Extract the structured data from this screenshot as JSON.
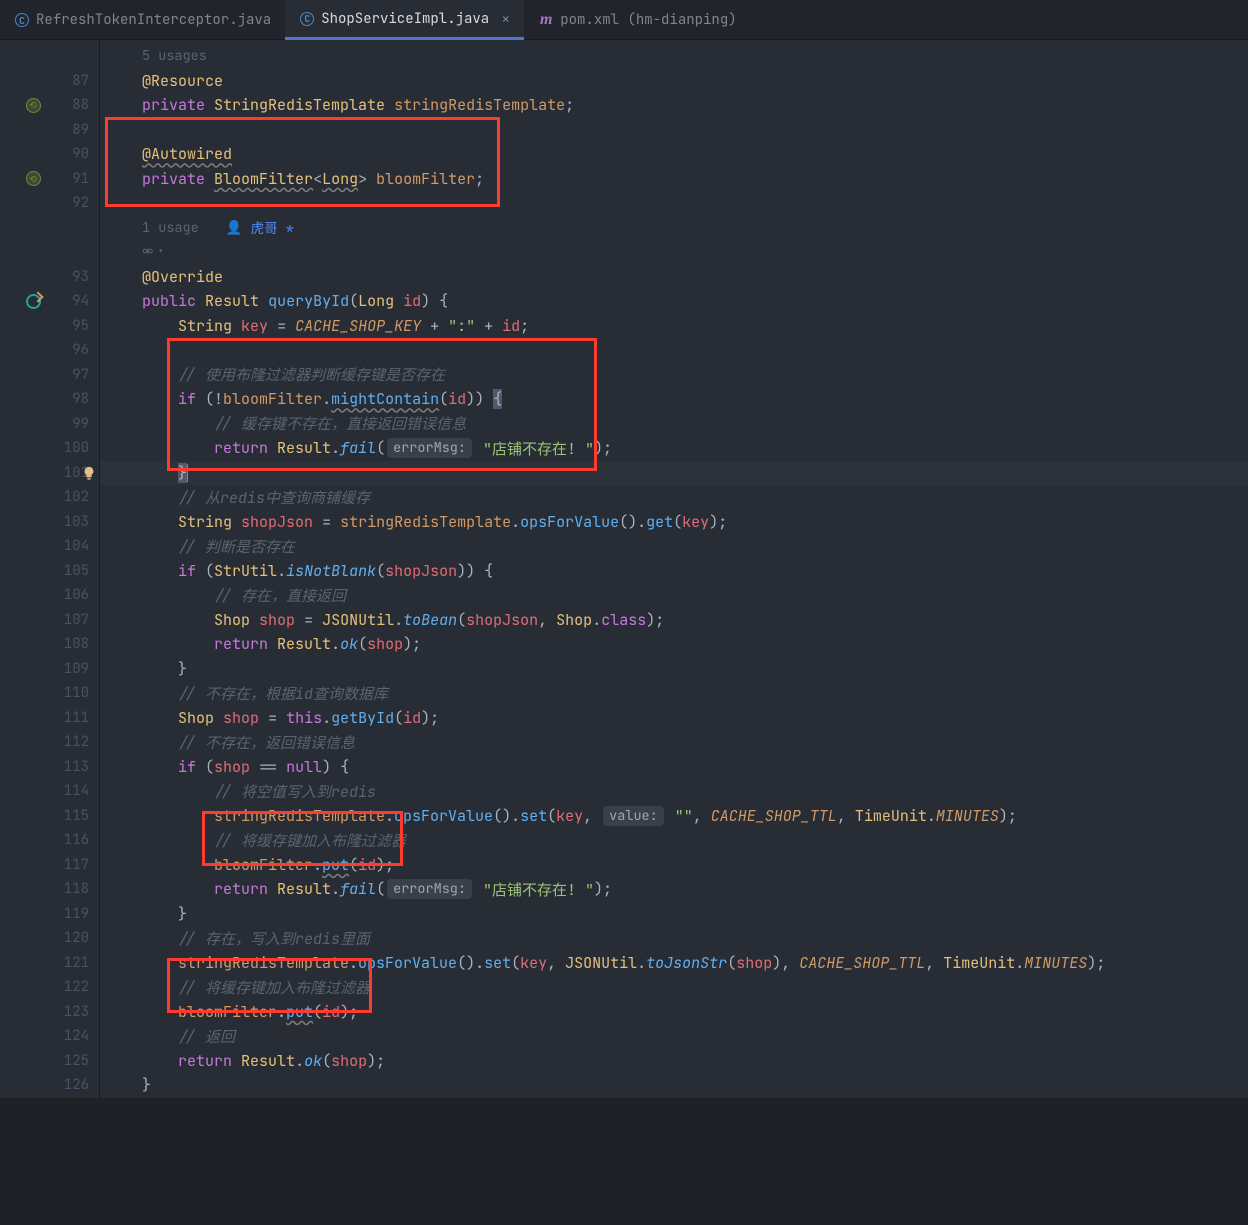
{
  "tabs": [
    {
      "label": "RefreshTokenInterceptor.java",
      "icon": "class"
    },
    {
      "label": "ShopServiceImpl.java",
      "icon": "class",
      "active": true
    },
    {
      "label": "pom.xml (hm-dianping)",
      "icon": "maven"
    }
  ],
  "inlay": {
    "usages5": "5 usages",
    "usage1": "1 usage",
    "author": "虎哥 *",
    "errorMsg": "errorMsg:",
    "value": "value:"
  },
  "lines": {
    "87": "",
    "88": "",
    "89": "",
    "90": "",
    "91": "",
    "92": "",
    "93": "",
    "94": "",
    "95": "",
    "96": "",
    "97_com": "// 使用布隆过滤器判断缓存键是否存在",
    "99_com": "// 缓存键不存在，直接返回错误信息",
    "100_str": "\"店铺不存在! \"",
    "102_com": "// 从redis中查询商铺缓存",
    "104_com": "// 判断是否存在",
    "106_com": "// 存在，直接返回",
    "110_com": "// 不存在，根据id查询数据库",
    "112_com": "// 不存在，返回错误信息",
    "114_com": "// 将空值写入到redis",
    "115_str": "\"\"",
    "116_com": "// 将缓存键加入布隆过滤器",
    "118_str": "\"店铺不存在! \"",
    "120_com": "// 存在，写入到redis里面",
    "122_com": "// 将缓存键加入布隆过滤器",
    "124_com": "// 返回"
  },
  "tokens": {
    "Resource": "@Resource",
    "Autowired": "@Autowired",
    "Override": "@Override",
    "private": "private",
    "public": "public",
    "return": "return",
    "if": "if",
    "this": "this",
    "null": "null",
    "StringRedisTemplate": "StringRedisTemplate",
    "stringRedisTemplate": "stringRedisTemplate",
    "BloomFilter": "BloomFilter",
    "Long": "Long",
    "bloomFilter": "bloomFilter",
    "Result": "Result",
    "queryById": "queryById",
    "id": "id",
    "String": "String",
    "key": "key",
    "CACHE_SHOP_KEY": "CACHE_SHOP_KEY",
    "colon": "\":\"",
    "mightContain": "mightContain",
    "fail": "fail",
    "shopJson": "shopJson",
    "opsForValue": "opsForValue",
    "get": "get",
    "StrUtil": "StrUtil",
    "isNotBlank": "isNotBlank",
    "Shop": "Shop",
    "shop": "shop",
    "JSONUtil": "JSONUtil",
    "toBean": "toBean",
    "class": "class",
    "ok": "ok",
    "getById": "getById",
    "set": "set",
    "CACHE_SHOP_TTL": "CACHE_SHOP_TTL",
    "TimeUnit": "TimeUnit",
    "MINUTES": "MINUTES",
    "put": "put",
    "toJsonStr": "toJsonStr"
  }
}
